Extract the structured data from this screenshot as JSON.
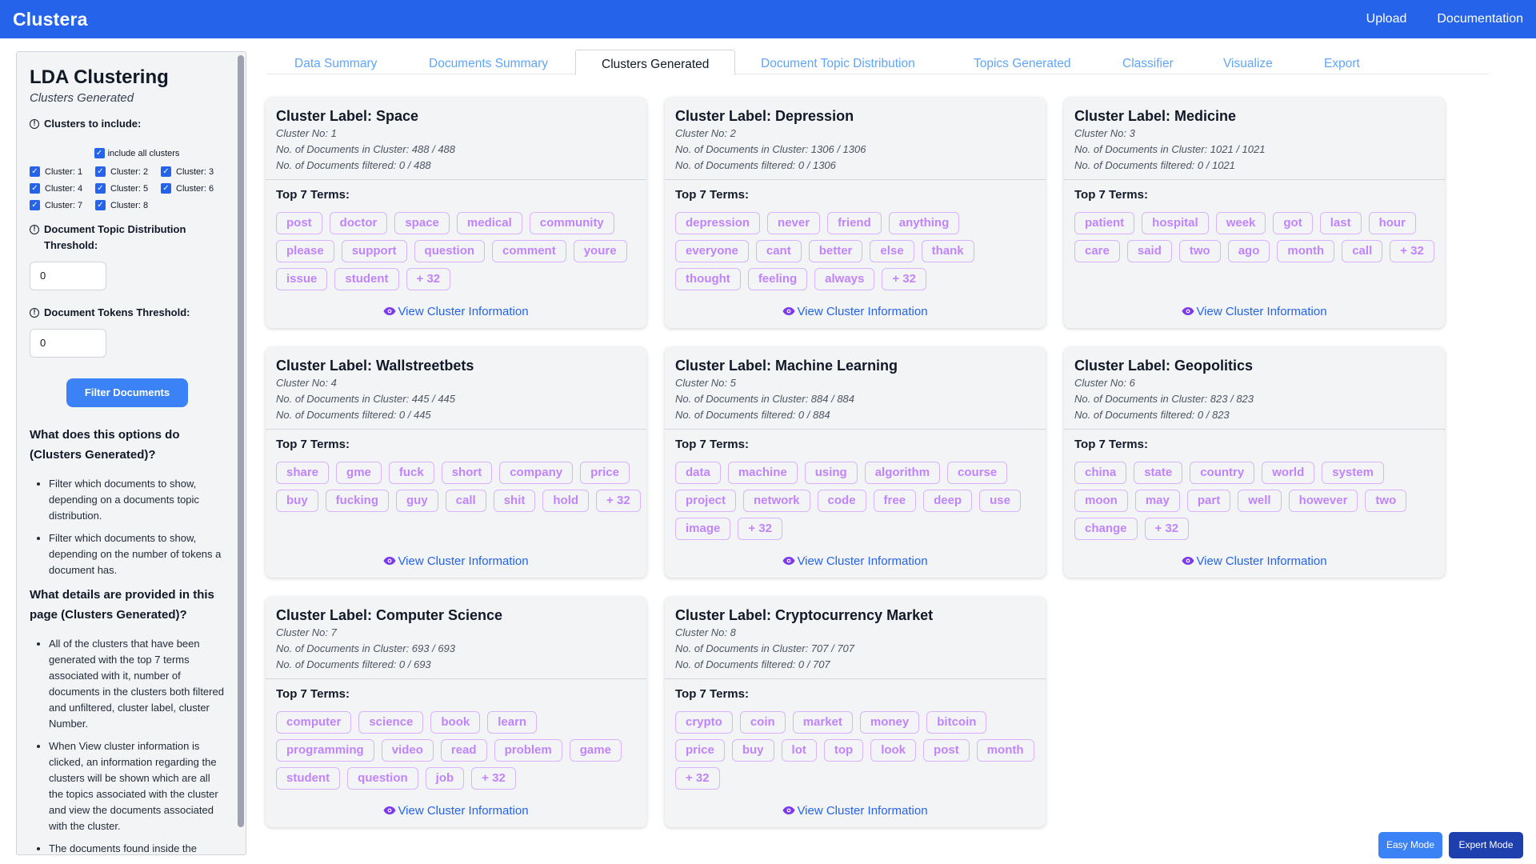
{
  "app": {
    "brand": "Clustera",
    "nav": [
      "Upload",
      "Documentation"
    ]
  },
  "sidebar": {
    "title": "LDA Clustering",
    "subtitle": "Clusters Generated",
    "clusters_label": "Clusters to include:",
    "include_all_label": "include all clusters",
    "cluster_checks": [
      "Cluster: 1",
      "Cluster: 2",
      "Cluster: 3",
      "Cluster: 4",
      "Cluster: 5",
      "Cluster: 6",
      "Cluster: 7",
      "Cluster: 8"
    ],
    "topic_threshold_label": "Document Topic Distribution Threshold:",
    "topic_threshold_value": "0",
    "tokens_threshold_label": "Document Tokens Threshold:",
    "tokens_threshold_value": "0",
    "filter_button": "Filter Documents",
    "help1_title": "What does this options do (Clusters Generated)?",
    "help1_items": [
      "Filter which documents to show, depending on a documents topic distribution.",
      "Filter which documents to show, depending on the number of tokens a document has."
    ],
    "help2_title": "What details are provided in this page (Clusters Generated)?",
    "help2_items": [
      "All of the clusters that have been generated with the top 7 terms associated with it, number of documents in the clusters both filtered and unfiltered, cluster label, cluster Number.",
      "When View cluster information is clicked, an information regarding the clusters will be shown which are all the topics associated with the cluster and view the documents associated with the cluster.",
      "The documents found inside the"
    ]
  },
  "tabs": [
    "Data Summary",
    "Documents Summary",
    "Clusters Generated",
    "Document Topic Distribution",
    "Topics Generated",
    "Classifier",
    "Visualize",
    "Export"
  ],
  "active_tab": "Clusters Generated",
  "top_terms_label": "Top 7 Terms:",
  "view_link": "View Cluster Information",
  "clusters": [
    {
      "title": "Cluster Label: Space",
      "no": "Cluster No: 1",
      "docs": "No. of Documents in Cluster: 488 / 488",
      "filtered": "No. of Documents filtered: 0 / 488",
      "terms": [
        "post",
        "doctor",
        "space",
        "medical",
        "community",
        "please",
        "support",
        "question",
        "comment",
        "youre",
        "issue",
        "student",
        "+ 32"
      ]
    },
    {
      "title": "Cluster Label: Depression",
      "no": "Cluster No: 2",
      "docs": "No. of Documents in Cluster: 1306 / 1306",
      "filtered": "No. of Documents filtered: 0 / 1306",
      "terms": [
        "depression",
        "never",
        "friend",
        "anything",
        "everyone",
        "cant",
        "better",
        "else",
        "thank",
        "thought",
        "feeling",
        "always",
        "+ 32"
      ]
    },
    {
      "title": "Cluster Label: Medicine",
      "no": "Cluster No: 3",
      "docs": "No. of Documents in Cluster: 1021 / 1021",
      "filtered": "No. of Documents filtered: 0 / 1021",
      "terms": [
        "patient",
        "hospital",
        "week",
        "got",
        "last",
        "hour",
        "care",
        "said",
        "two",
        "ago",
        "month",
        "call",
        "+ 32"
      ]
    },
    {
      "title": "Cluster Label: Wallstreetbets",
      "no": "Cluster No: 4",
      "docs": "No. of Documents in Cluster: 445 / 445",
      "filtered": "No. of Documents filtered: 0 / 445",
      "terms": [
        "share",
        "gme",
        "fuck",
        "short",
        "company",
        "price",
        "buy",
        "fucking",
        "guy",
        "call",
        "shit",
        "hold",
        "+ 32"
      ]
    },
    {
      "title": "Cluster Label: Machine Learning",
      "no": "Cluster No: 5",
      "docs": "No. of Documents in Cluster: 884 / 884",
      "filtered": "No. of Documents filtered: 0 / 884",
      "terms": [
        "data",
        "machine",
        "using",
        "algorithm",
        "course",
        "project",
        "network",
        "code",
        "free",
        "deep",
        "use",
        "image",
        "+ 32"
      ]
    },
    {
      "title": "Cluster Label: Geopolitics",
      "no": "Cluster No: 6",
      "docs": "No. of Documents in Cluster: 823 / 823",
      "filtered": "No. of Documents filtered: 0 / 823",
      "terms": [
        "china",
        "state",
        "country",
        "world",
        "system",
        "moon",
        "may",
        "part",
        "well",
        "however",
        "two",
        "change",
        "+ 32"
      ]
    },
    {
      "title": "Cluster Label: Computer Science",
      "no": "Cluster No: 7",
      "docs": "No. of Documents in Cluster: 693 / 693",
      "filtered": "No. of Documents filtered: 0 / 693",
      "terms": [
        "computer",
        "science",
        "book",
        "learn",
        "programming",
        "video",
        "read",
        "problem",
        "game",
        "student",
        "question",
        "job",
        "+ 32"
      ]
    },
    {
      "title": "Cluster Label: Cryptocurrency Market",
      "no": "Cluster No: 8",
      "docs": "No. of Documents in Cluster: 707 / 707",
      "filtered": "No. of Documents filtered: 0 / 707",
      "terms": [
        "crypto",
        "coin",
        "market",
        "money",
        "bitcoin",
        "price",
        "buy",
        "lot",
        "top",
        "look",
        "post",
        "month",
        "+ 32"
      ]
    }
  ],
  "modes": {
    "easy": "Easy Mode",
    "expert": "Expert Mode"
  },
  "colors": {
    "primary": "#2563eb",
    "term_text": "#c084fc",
    "term_border": "#d8b4fe",
    "tab_link": "#60a5fa"
  }
}
